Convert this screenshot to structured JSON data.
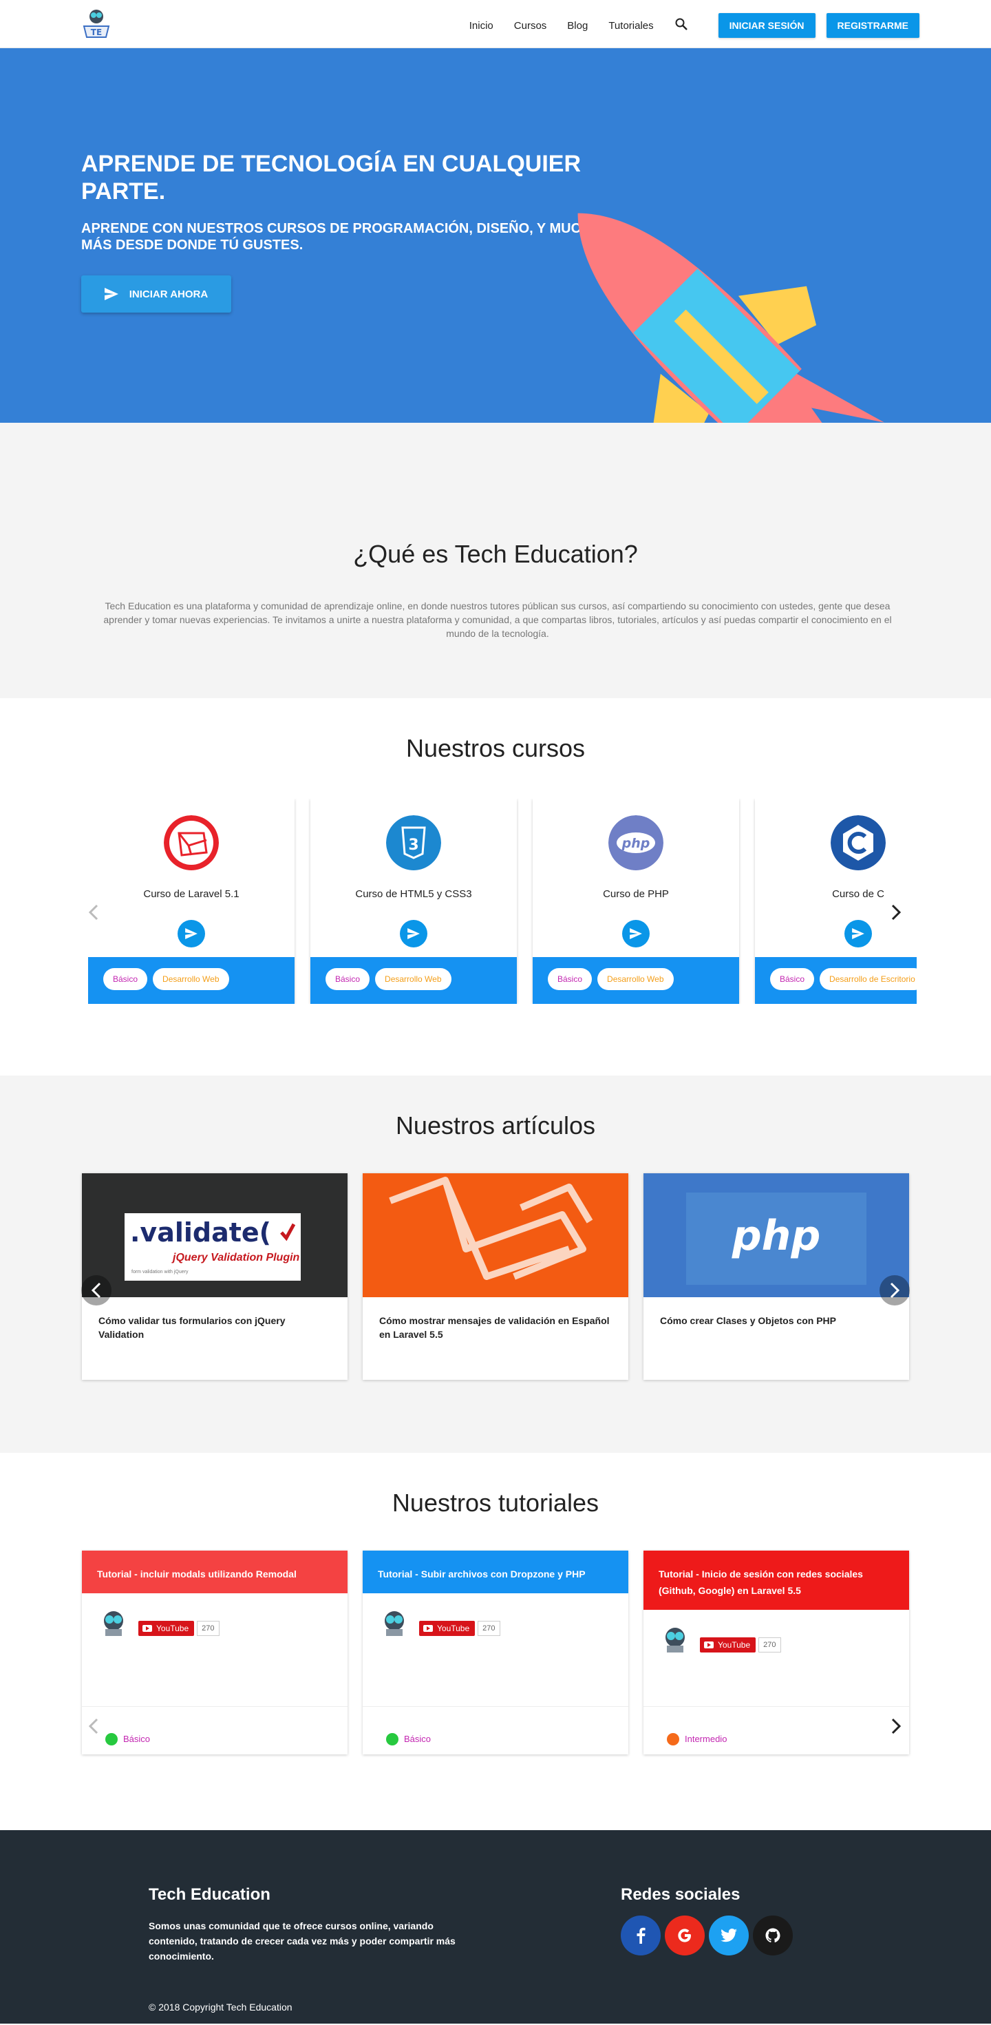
{
  "nav": {
    "links": [
      "Inicio",
      "Cursos",
      "Blog",
      "Tutoriales"
    ],
    "login": "INICIAR SESIÓN",
    "register": "REGISTRARME"
  },
  "hero": {
    "title": "APRENDE DE TECNOLOGÍA EN CUALQUIER PARTE.",
    "subtitle": "APRENDE CON NUESTROS CURSOS DE PROGRAMACIÓN, DISEÑO, Y MUCHO MÁS DESDE DONDE TÚ GUSTES.",
    "cta": "INICIAR AHORA"
  },
  "about": {
    "title": "¿Qué es Tech Education?",
    "text": "Tech Education es una plataforma y comunidad de aprendizaje online, en donde nuestros tutores públican sus cursos, así compartiendo su conocimiento con ustedes, gente que desea aprender y tomar nuevas experiencias. Te invitamos a unirte a nuestra plataforma y comunidad, a que compartas libros, tutoriales, artículos y así puedas compartir el conocimiento en el mundo de la tecnología."
  },
  "courses": {
    "title": "Nuestros cursos",
    "items": [
      {
        "name": "Curso de Laravel 5.1",
        "level": "Básico",
        "category": "Desarrollo Web"
      },
      {
        "name": "Curso de HTML5 y CSS3",
        "level": "Básico",
        "category": "Desarrollo Web"
      },
      {
        "name": "Curso de PHP",
        "level": "Básico",
        "category": "Desarrollo Web"
      },
      {
        "name": "Curso de C",
        "level": "Básico",
        "category": "Desarrollo de Escritorio"
      }
    ],
    "logo_text": {
      "php": "php"
    }
  },
  "articles": {
    "title": "Nuestros artículos",
    "items": [
      {
        "title": "Cómo validar tus formularios con jQuery Validation",
        "image_text": ".validate(",
        "image_sub": "jQuery Validation Plugin",
        "image_small": "form validation with jQuery"
      },
      {
        "title": "Cómo mostrar mensajes de validación en Español en Laravel 5.5"
      },
      {
        "title": "Cómo crear Clases y Objetos con PHP",
        "image_text": "php"
      }
    ]
  },
  "tutorials": {
    "title": "Nuestros tutoriales",
    "youtube_label": "YouTube",
    "items": [
      {
        "title": "Tutorial - incluir modals utilizando Remodal",
        "count": "270",
        "level": "Básico",
        "color": "#f44242",
        "dot": "#27c93f"
      },
      {
        "title": "Tutorial - Subir archivos con Dropzone y PHP",
        "count": "270",
        "level": "Básico",
        "color": "#1592f2",
        "dot": "#27c93f"
      },
      {
        "title": "Tutorial - Inicio de sesión con redes sociales (Github, Google) en Laravel 5.5",
        "count": "270",
        "level": "Intermedio",
        "color": "#ee1a1a",
        "dot": "#f56a1a"
      }
    ]
  },
  "footer": {
    "title": "Tech Education",
    "description": "Somos unas comunidad que te ofrece cursos online, variando contenido, tratando de crecer cada vez más y poder compartir más conocimiento.",
    "social_title": "Redes sociales",
    "social": [
      {
        "name": "facebook",
        "glyph": "f",
        "color": "#1f56b3"
      },
      {
        "name": "google",
        "glyph": "G",
        "color": "#ec2a1d"
      },
      {
        "name": "twitter",
        "glyph": "t",
        "color": "#1da1f2"
      },
      {
        "name": "github",
        "glyph": "gh",
        "color": "#1a1a1a"
      }
    ],
    "copyright": "© 2018 Copyright Tech Education"
  }
}
